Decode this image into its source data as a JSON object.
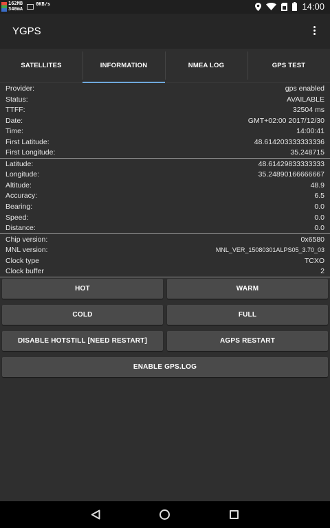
{
  "status_bar": {
    "mem_line1": "162MB",
    "mem_line2": "340mA",
    "net_speed": "0KB/s",
    "time": "14:00"
  },
  "app": {
    "title": "YGPS"
  },
  "tabs": [
    {
      "label": "SATELLITES"
    },
    {
      "label": "INFORMATION",
      "active": true
    },
    {
      "label": "NMEA LOG"
    },
    {
      "label": "GPS TEST"
    }
  ],
  "info": {
    "group1": [
      {
        "key": "Provider:",
        "value": "gps enabled"
      },
      {
        "key": "Status:",
        "value": "AVAILABLE"
      },
      {
        "key": "TTFF:",
        "value": "32504 ms"
      },
      {
        "key": "Date:",
        "value": "GMT+02:00 2017/12/30"
      },
      {
        "key": "Time:",
        "value": "14:00:41"
      },
      {
        "key": "First Latitude:",
        "value": "48.614203333333336"
      },
      {
        "key": "First Longitude:",
        "value": "35.248715"
      }
    ],
    "group2": [
      {
        "key": "Latitude:",
        "value": "48.61429833333333"
      },
      {
        "key": "Longitude:",
        "value": "35.24890166666667"
      },
      {
        "key": "Altitude:",
        "value": "48.9"
      },
      {
        "key": "Accuracy:",
        "value": "6.5"
      },
      {
        "key": "Bearing:",
        "value": "0.0"
      },
      {
        "key": "Speed:",
        "value": "0.0"
      },
      {
        "key": "Distance:",
        "value": "0.0"
      }
    ],
    "group3": [
      {
        "key": "Chip version:",
        "value": "0x6580"
      },
      {
        "key": "MNL version:",
        "value": "MNL_VER_15080301ALPS05_3.70_03"
      },
      {
        "key": "Clock type",
        "value": "TCXO"
      },
      {
        "key": "Clock buffer",
        "value": "2"
      }
    ]
  },
  "buttons": {
    "hot": "HOT",
    "warm": "WARM",
    "cold": "COLD",
    "full": "FULL",
    "disable_hotstill": "DISABLE HOTSTILL [NEED RESTART]",
    "agps_restart": "AGPS RESTART",
    "enable_gps_log": "ENABLE GPS.LOG"
  },
  "icons": {
    "status": [
      "location-icon",
      "wifi-icon",
      "sim-icon",
      "battery-icon"
    ],
    "nav": [
      "back-icon",
      "home-icon",
      "recent-apps-icon"
    ],
    "overflow": "more-vert-icon"
  },
  "colors": {
    "accent": "#6fa8dc",
    "background": "#2f2f2f",
    "button": "#4a4a4a"
  }
}
